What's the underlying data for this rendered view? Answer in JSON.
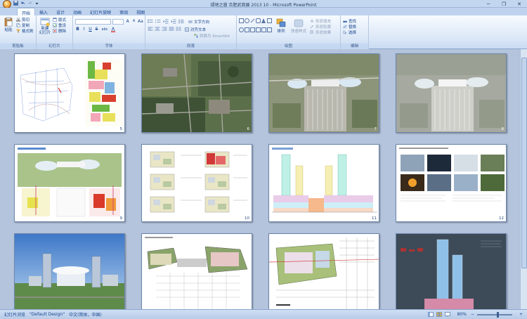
{
  "window": {
    "title": "绿地之窗 合肥武商展 2013 10 - Microsoft PowerPoint",
    "minimize": "─",
    "maximize": "❐",
    "close": "✕"
  },
  "ribbon_tabs": [
    "开始",
    "插入",
    "设计",
    "动画",
    "幻灯片放映",
    "审阅",
    "视图"
  ],
  "groups": {
    "clipboard": {
      "label": "剪贴板",
      "paste": "粘贴",
      "cut": "剪切",
      "copy": "复制",
      "format_painter": "格式刷"
    },
    "slides": {
      "label": "幻灯片",
      "new_slide": "新建\n幻灯片",
      "layout": "版式",
      "reset": "重设",
      "delete": "删除"
    },
    "font": {
      "label": "字体",
      "bold": "B",
      "italic": "I",
      "underline": "U",
      "strike": "S",
      "shadow": "abc",
      "grow": "A",
      "shrink": "A",
      "clear": "Aa"
    },
    "paragraph": {
      "label": "段落",
      "text_direction": "文字方向",
      "align_text": "对齐文本",
      "smartart": "转换为 SmartArt"
    },
    "drawing": {
      "label": "绘图",
      "arrange": "排列",
      "quick_styles": "快速样式",
      "fill": "形状填充",
      "outline": "形状轮廓",
      "effects": "形状效果"
    },
    "editing": {
      "label": "编辑",
      "find": "查找",
      "replace": "替换",
      "select": "选择"
    }
  },
  "slides": [
    {
      "number": "5",
      "kind": "map-plan"
    },
    {
      "number": "6",
      "kind": "aerial-photo"
    },
    {
      "number": "7",
      "kind": "site-render"
    },
    {
      "number": "8",
      "kind": "site-render-faded"
    },
    {
      "number": "9",
      "kind": "plan-sections"
    },
    {
      "number": "10",
      "kind": "floor-plans"
    },
    {
      "number": "11",
      "kind": "section-diagram"
    },
    {
      "number": "12",
      "kind": "photo-grid"
    },
    {
      "number": "",
      "kind": "city-render"
    },
    {
      "number": "",
      "kind": "plan-drawing"
    },
    {
      "number": "",
      "kind": "site-plan"
    },
    {
      "number": "",
      "kind": "tower-elevation"
    }
  ],
  "status": {
    "view": "幻灯片浏览",
    "theme": "\"Default Design\"",
    "language": "中文(简体，中国)",
    "zoom": "80%"
  },
  "colors": {
    "ribbon_bg": "#dbe7f7",
    "workspace": "#b4c4dc",
    "accent": "#15428b"
  }
}
